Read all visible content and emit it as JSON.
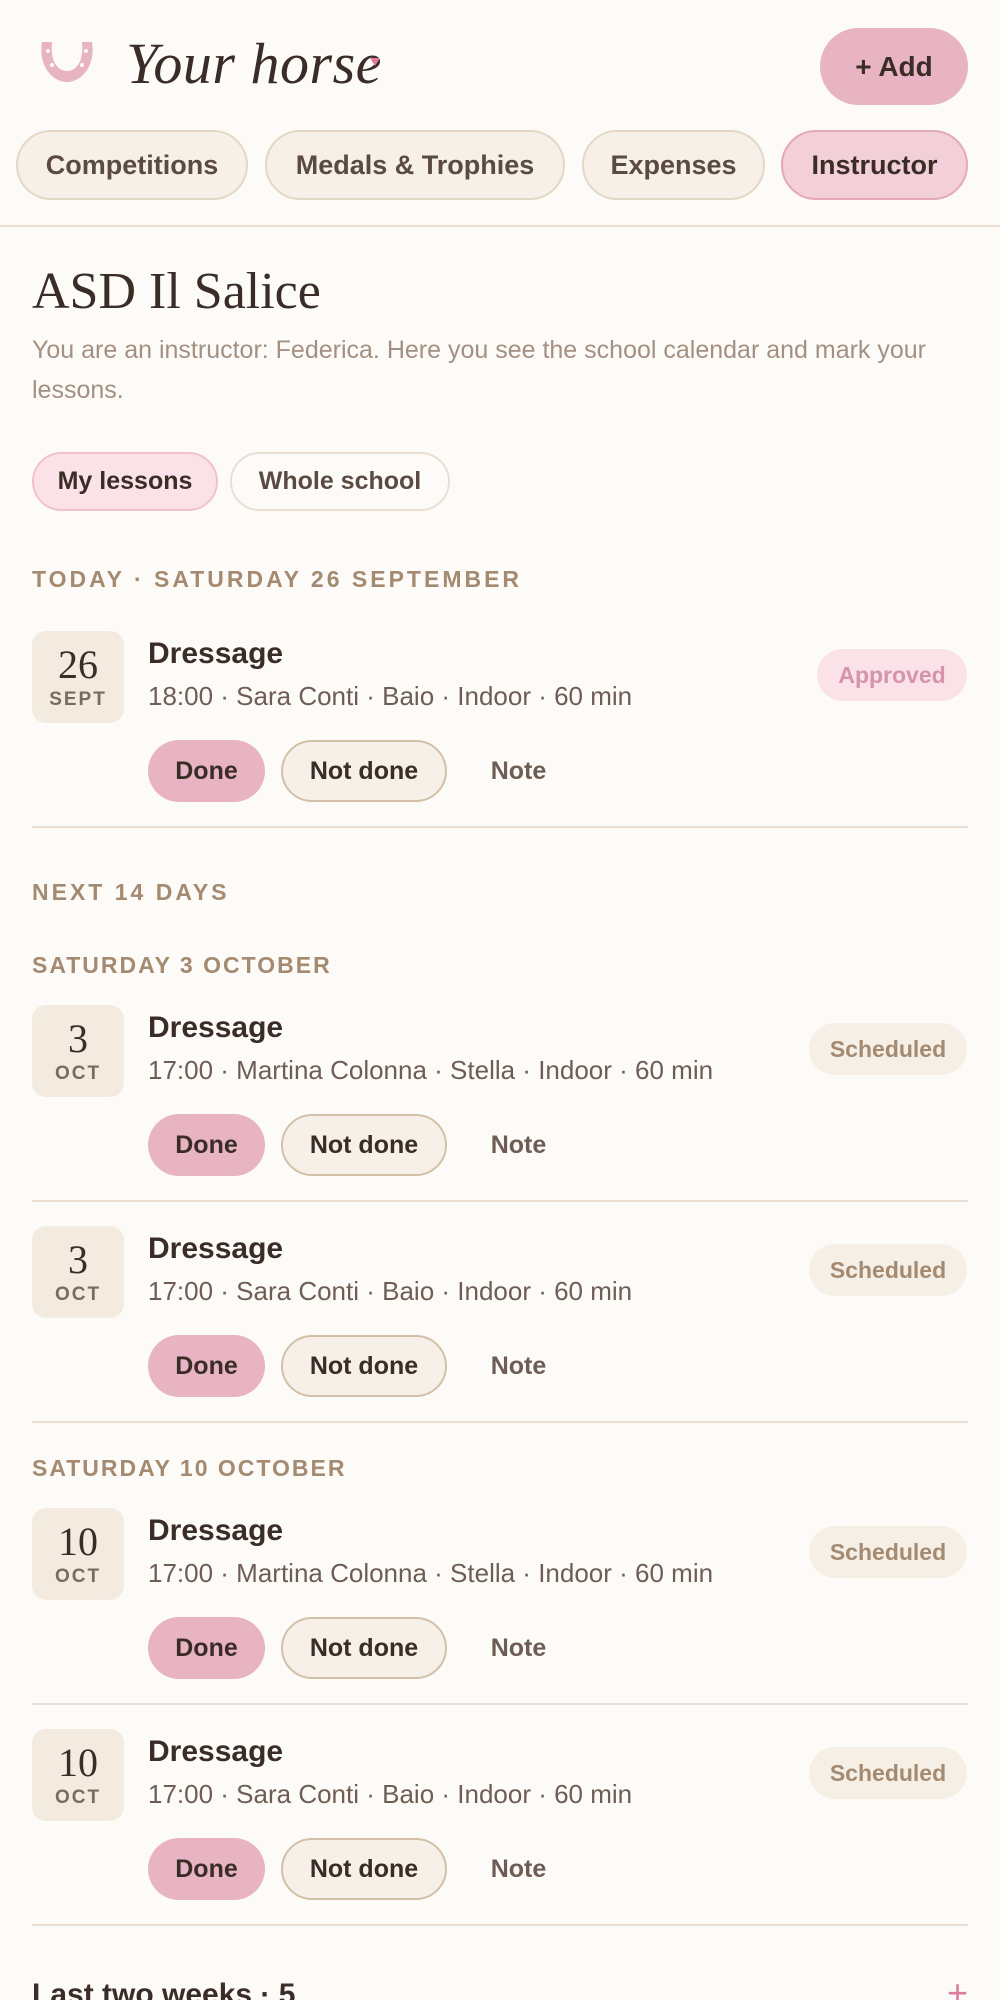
{
  "header": {
    "title": "Your horse",
    "add_label": "+ Add",
    "logo_icon": "horseshoe-icon",
    "accent": "#e8b3c2"
  },
  "tabs": [
    {
      "label": "Competitions",
      "active": false
    },
    {
      "label": "Medals & Trophies",
      "active": false
    },
    {
      "label": "Expenses",
      "active": false
    },
    {
      "label": "Instructor",
      "active": true
    }
  ],
  "school": {
    "name": "ASD Il Salice",
    "subtitle": "You are an instructor: Federica. Here you see the school calendar and mark your lessons."
  },
  "filters": [
    {
      "label": "My lessons",
      "active": true
    },
    {
      "label": "Whole school",
      "active": false
    }
  ],
  "today": {
    "label": "TODAY · SATURDAY 26 SEPTEMBER",
    "lessons": [
      {
        "day": "26",
        "month": "SEPT",
        "title": "Dressage",
        "meta": "18:00 · Sara Conti · Baio · Indoor · 60 min",
        "status": "Approved"
      }
    ]
  },
  "upcoming": {
    "label": "NEXT 14 DAYS",
    "groups": [
      {
        "label": "SATURDAY 3 OCTOBER",
        "lessons": [
          {
            "day": "3",
            "month": "OCT",
            "title": "Dressage",
            "meta": "17:00 · Martina Colonna · Stella · Indoor · 60 min",
            "status": "Scheduled"
          },
          {
            "day": "3",
            "month": "OCT",
            "title": "Dressage",
            "meta": "17:00 · Sara Conti · Baio · Indoor · 60 min",
            "status": "Scheduled"
          }
        ]
      },
      {
        "label": "SATURDAY 10 OCTOBER",
        "lessons": [
          {
            "day": "10",
            "month": "OCT",
            "title": "Dressage",
            "meta": "17:00 · Martina Colonna · Stella · Indoor · 60 min",
            "status": "Scheduled"
          },
          {
            "day": "10",
            "month": "OCT",
            "title": "Dressage",
            "meta": "17:00 · Sara Conti · Baio · Indoor · 60 min",
            "status": "Scheduled"
          }
        ]
      }
    ]
  },
  "actions": {
    "done": "Done",
    "not_done": "Not done",
    "note": "Note"
  },
  "footer": {
    "label": "Last two weeks · 5",
    "expand_icon": "plus-icon"
  }
}
